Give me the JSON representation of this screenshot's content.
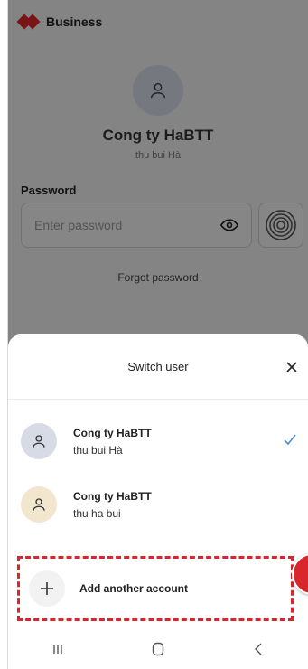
{
  "app": {
    "brand": "Business",
    "company": "Cong ty HaBTT",
    "username": "thu bui Hà",
    "password_label": "Password",
    "password_placeholder": "Enter password",
    "forgot_password": "Forgot password"
  },
  "sheet": {
    "title": "Switch user",
    "accounts": [
      {
        "company": "Cong ty HaBTT",
        "user": "thu bui Hà",
        "selected": true,
        "avatar_color": "#d6dbe6"
      },
      {
        "company": "Cong ty HaBTT",
        "user": "thu ha bui",
        "selected": false,
        "avatar_color": "#f3e6cf"
      }
    ],
    "add_account": "Add another account"
  },
  "colors": {
    "brand_red": "#d8262c",
    "check_blue": "#4a8fe0"
  },
  "icons": [
    "logo-icon",
    "user-icon",
    "eye-icon",
    "fingerprint-icon",
    "close-icon",
    "check-icon",
    "plus-icon",
    "recents-icon",
    "home-icon",
    "back-icon"
  ]
}
